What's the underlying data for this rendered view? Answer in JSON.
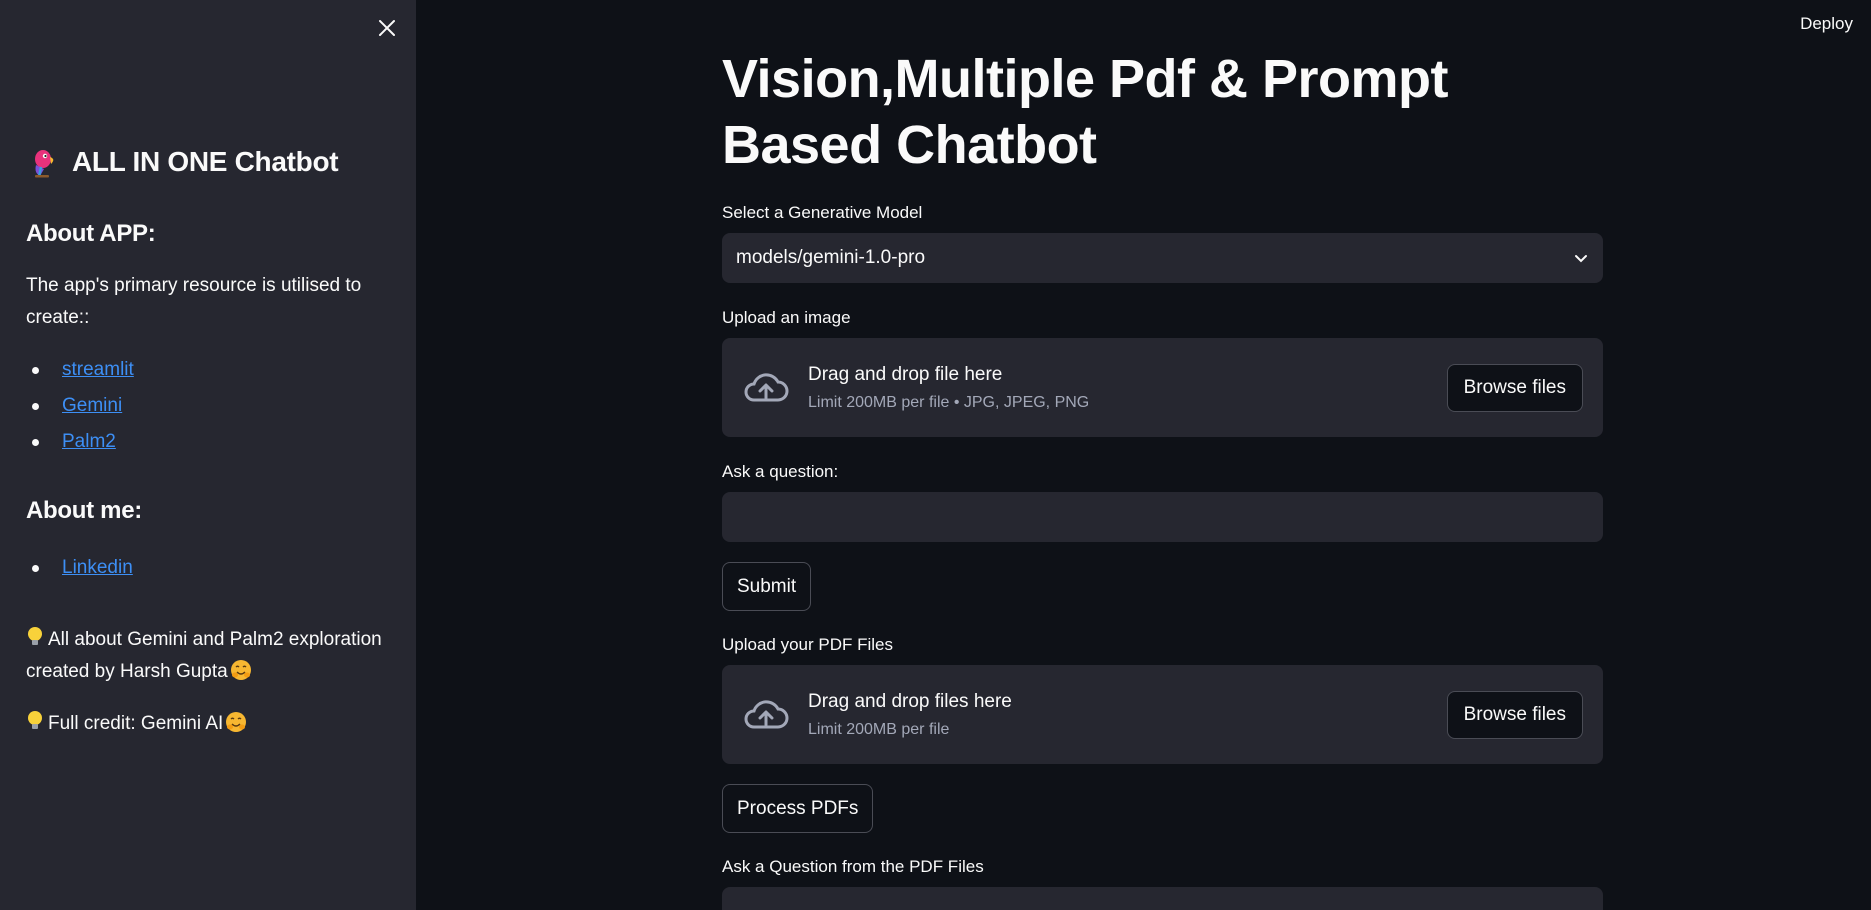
{
  "sidebar": {
    "title": "ALL IN ONE Chatbot",
    "about_app_heading": "About APP:",
    "about_app_text": "The app's primary resource is utilised to create::",
    "resources": [
      {
        "label": "streamlit"
      },
      {
        "label": "Gemini"
      },
      {
        "label": "Palm2"
      }
    ],
    "about_me_heading": "About me:",
    "about_me_links": [
      {
        "label": "Linkedin"
      }
    ],
    "note1": "All about Gemini and Palm2 exploration created by Harsh Gupta",
    "note2": "Full credit: Gemini AI"
  },
  "header": {
    "deploy_label": "Deploy"
  },
  "main": {
    "title": "Vision,Multiple Pdf & Prompt Based Chatbot",
    "model_label": "Select a Generative Model",
    "model_value": "models/gemini-1.0-pro",
    "image_upload_label": "Upload an image",
    "image_drop_text": "Drag and drop file here",
    "image_drop_limit": "Limit 200MB per file • JPG, JPEG, PNG",
    "browse_label": "Browse files",
    "question_label": "Ask a question:",
    "question_value": "",
    "submit_label": "Submit",
    "pdf_upload_label": "Upload your PDF Files",
    "pdf_drop_text": "Drag and drop files here",
    "pdf_drop_limit": "Limit 200MB per file",
    "process_label": "Process PDFs",
    "pdf_question_label": "Ask a Question from the PDF Files"
  },
  "colors": {
    "background": "#0e1117",
    "sidebar": "#262730",
    "link": "#3d8ff5",
    "field": "#262730"
  }
}
